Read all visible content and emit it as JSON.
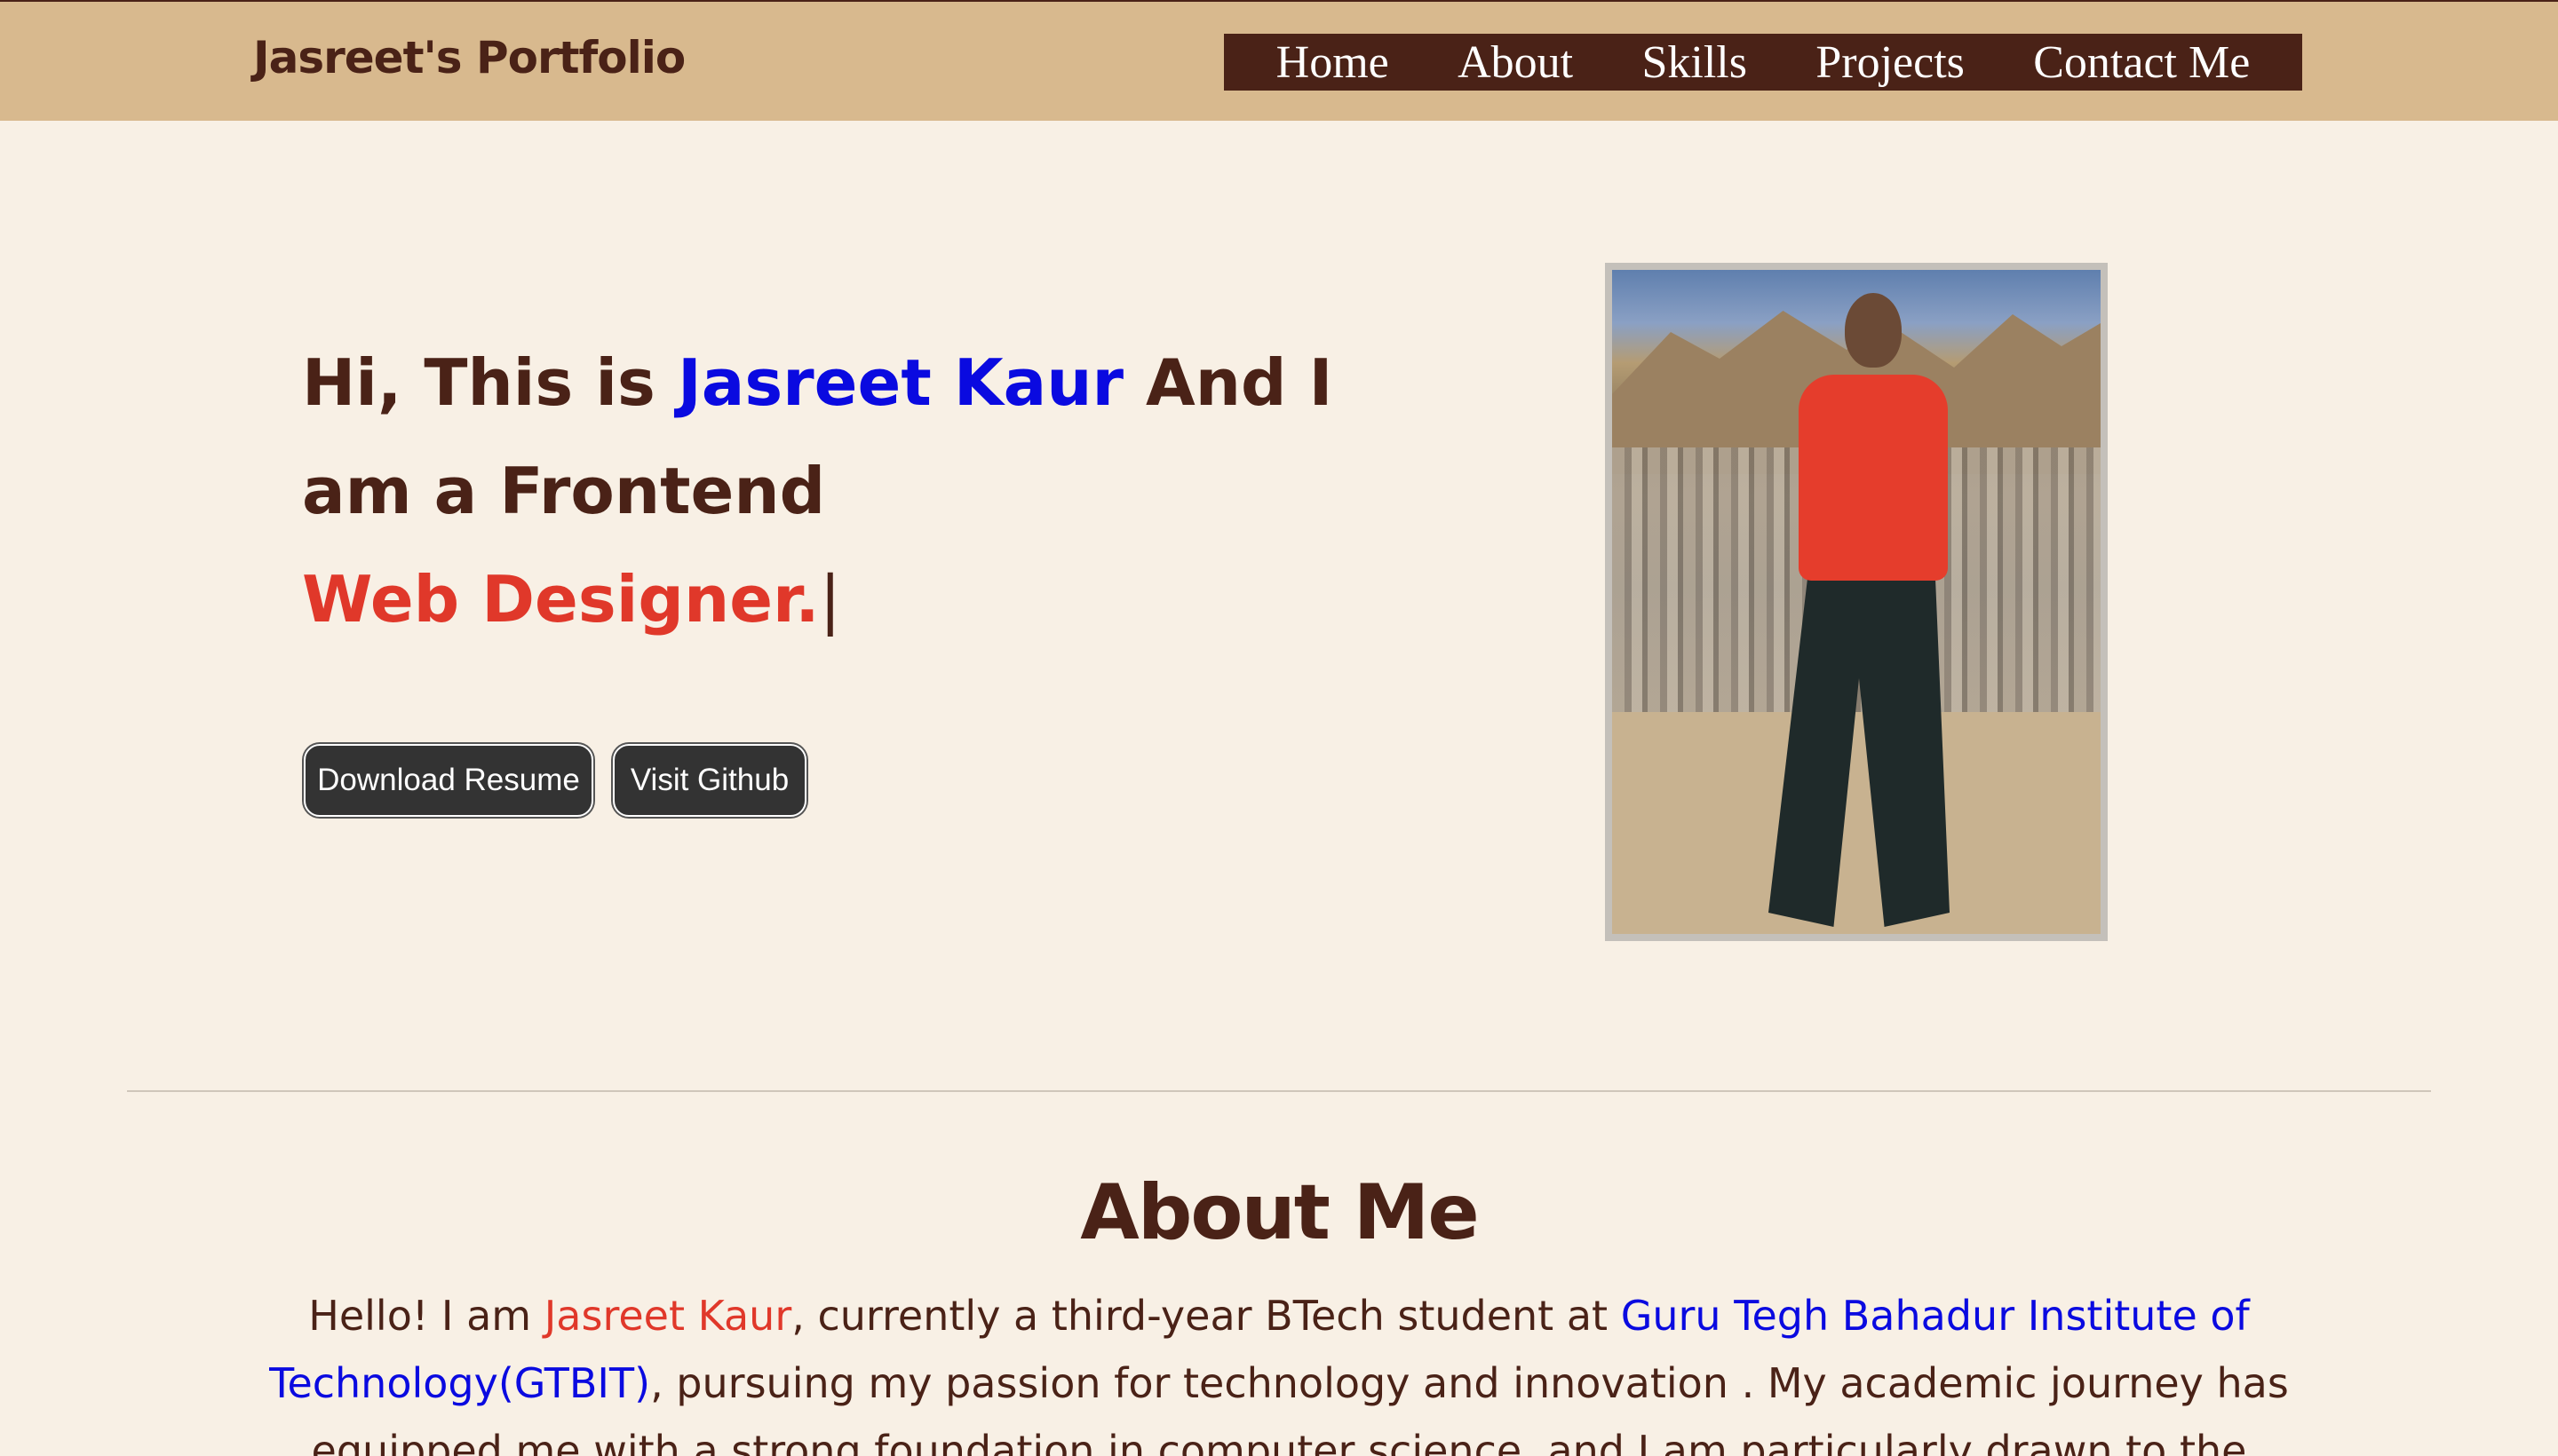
{
  "header": {
    "brand": "Jasreet's Portfolio",
    "nav": [
      "Home",
      "About",
      "Skills",
      "Projects",
      "Contact Me"
    ]
  },
  "hero": {
    "line1_prefix": "Hi, This is ",
    "line1_name": "Jasreet Kaur",
    "line1_suffix": " And I",
    "line2": "am a Frontend",
    "line3": "Web Designer.",
    "cursor": "|",
    "buttons": {
      "resume": "Download Resume",
      "github": "Visit Github"
    },
    "photo_icon": "profile-photo"
  },
  "about": {
    "title": "About Me",
    "p_intro": "Hello! I am ",
    "p_name": "Jasreet Kaur",
    "p_mid": ", currently a third-year BTech student at ",
    "p_college": "Guru Tegh Bahadur Institute of Technology(GTBIT)",
    "p_rest": ", pursuing my passion for technology and innovation . My academic journey has equipped me with a strong foundation in computer science, and I am particularly drawn to the"
  },
  "colors": {
    "header_bg": "#d8b98e",
    "nav_bg": "#4a2217",
    "page_bg": "#f8f0e5",
    "text": "#4a2217",
    "accent_blue": "#0a0ae0",
    "accent_red": "#e0382a",
    "button_bg": "#333333"
  }
}
